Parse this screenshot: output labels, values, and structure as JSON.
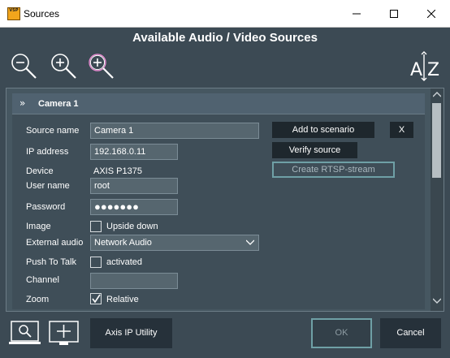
{
  "window": {
    "title": "Sources",
    "icon_text": "VSP",
    "controls": [
      "minimize",
      "maximize",
      "close"
    ]
  },
  "heading": "Available Audio / Video Sources",
  "toolbar": {
    "icons": [
      "zoom-out-icon",
      "zoom-in-icon",
      "zoom-in-highlight-icon",
      "sort-az-icon"
    ],
    "sort_label_a": "A",
    "sort_label_z": "Z"
  },
  "camera": {
    "title": "Camera 1",
    "fields": {
      "source_name_label": "Source name",
      "source_name_value": "Camera 1",
      "ip_label": "IP address",
      "ip_value": "192.168.0.11",
      "device_label": "Device",
      "device_value": "AXIS P1375",
      "user_label": "User name",
      "user_value": "root",
      "password_label": "Password",
      "password_value": "●●●●●●●",
      "image_label": "Image",
      "upside_down_label": "Upside down",
      "upside_down_checked": false,
      "external_audio_label": "External audio",
      "external_audio_value": "Network Audio",
      "push_to_talk_label": "Push To Talk",
      "activated_label": "activated",
      "activated_checked": false,
      "channel_label": "Channel",
      "channel_value": "",
      "zoom_label": "Zoom",
      "relative_label": "Relative",
      "relative_checked": true
    },
    "buttons": {
      "add_to_scenario": "Add to scenario",
      "remove": "X",
      "verify_source": "Verify source",
      "create_rtsp": "Create RTSP-stream"
    }
  },
  "footer": {
    "search_icon": "search-display-icon",
    "add_icon": "add-display-icon",
    "axis_ip_utility": "Axis IP Utility",
    "ok": "OK",
    "cancel": "Cancel"
  },
  "colors": {
    "background": "#3c4a54",
    "panel": "#465761",
    "dark_button": "#26313a",
    "accent_outline": "#6fa0a6",
    "input_bg": "#56666f"
  }
}
